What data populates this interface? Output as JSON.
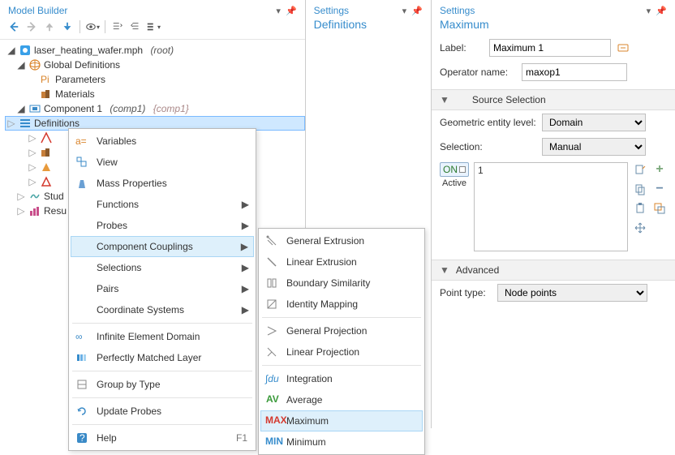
{
  "left": {
    "title": "Model Builder",
    "tree": {
      "root": {
        "label": "laser_heating_wafer.mph",
        "suffix": "(root)"
      },
      "global": {
        "label": "Global Definitions",
        "children": {
          "params": "Parameters",
          "materials": "Materials"
        }
      },
      "comp": {
        "label": "Component 1",
        "suffix1": "(comp1)",
        "suffix2": "{comp1}"
      },
      "defs": "Definitions",
      "studies": "Stud",
      "results": "Resu"
    }
  },
  "middle": {
    "title": "Settings",
    "subtitle": "Definitions"
  },
  "right": {
    "title": "Settings",
    "subtitle": "Maximum",
    "label_field": "Label:",
    "label_value": "Maximum 1",
    "op_field": "Operator name:",
    "op_value": "maxop1",
    "source_hdr": "Source Selection",
    "geo_lbl": "Geometric entity level:",
    "geo_val": "Domain",
    "sel_lbl": "Selection:",
    "sel_val": "Manual",
    "active_lbl": "Active",
    "active_on": "ON",
    "list_item": "1",
    "adv_hdr": "Advanced",
    "pt_lbl": "Point type:",
    "pt_val": "Node points"
  },
  "ctx1": {
    "variables": "Variables",
    "view": "View",
    "mass": "Mass Properties",
    "functions": "Functions",
    "probes": "Probes",
    "coupl": "Component Couplings",
    "selections": "Selections",
    "pairs": "Pairs",
    "coord": "Coordinate Systems",
    "ied": "Infinite Element Domain",
    "pml": "Perfectly Matched Layer",
    "group": "Group by Type",
    "update": "Update Probes",
    "help": "Help",
    "help_key": "F1"
  },
  "ctx2": {
    "genext": "General Extrusion",
    "linext": "Linear Extrusion",
    "bsim": "Boundary Similarity",
    "idmap": "Identity Mapping",
    "genproj": "General Projection",
    "linproj": "Linear Projection",
    "integ": "Integration",
    "avg": "Average",
    "max": "Maximum",
    "min": "Minimum"
  }
}
